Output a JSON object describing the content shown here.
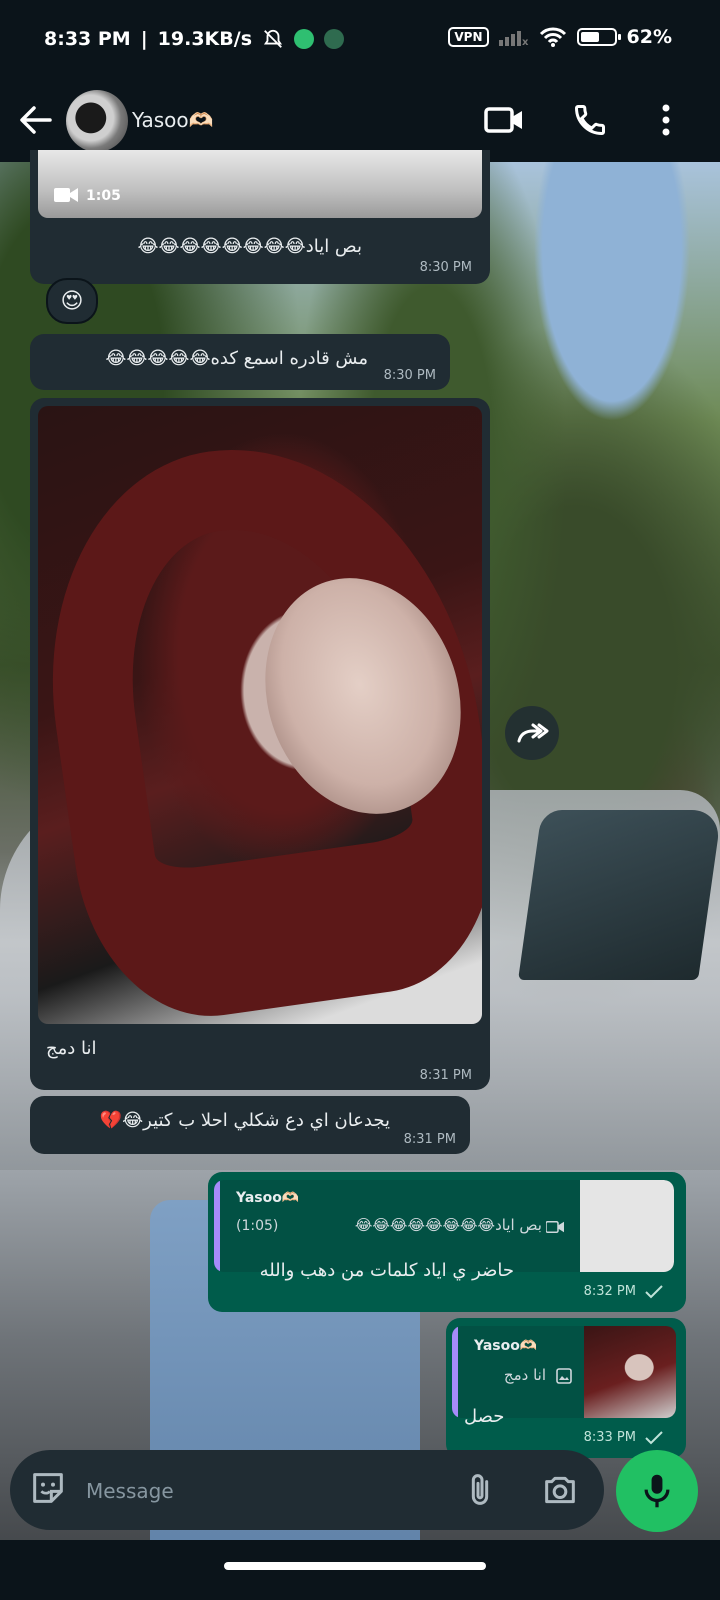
{
  "status_bar": {
    "time": "8:33 PM",
    "network_speed": "19.3KB/s",
    "vpn": "VPN",
    "battery": "62%",
    "battery_level": 0.62
  },
  "header": {
    "contact_name": "Yasoo🫶🏻"
  },
  "messages": [
    {
      "direction": "incoming",
      "type": "video",
      "video_duration": "1:05",
      "text": "بص اياد😂😂😂😂😂😂😂😂",
      "time": "8:30 PM",
      "reaction": "😍"
    },
    {
      "direction": "incoming",
      "type": "text",
      "text": "مش قادره اسمع كده😂😂😂😂😂",
      "time": "8:30 PM"
    },
    {
      "direction": "incoming",
      "type": "image",
      "text": "انا دمج",
      "time": "8:31 PM"
    },
    {
      "direction": "incoming",
      "type": "text",
      "text": "يجدعان اي دع شكلي احلا ب كتير😂💔",
      "time": "8:31 PM"
    },
    {
      "direction": "outgoing",
      "type": "reply",
      "quote_author": "Yasoo🫶🏻",
      "quote_text": "بص اياد😂😂😂😂😂😂😂😂",
      "quote_duration": "(1:05)",
      "text": "حاضر ي اياد كلمات من دهب والله",
      "time": "8:32 PM",
      "status": "sent"
    },
    {
      "direction": "outgoing",
      "type": "reply",
      "quote_author": "Yasoo🫶🏻",
      "quote_text": "انا دمج",
      "text": "حصل",
      "time": "8:33 PM",
      "status": "sent"
    }
  ],
  "composer": {
    "placeholder": "Message"
  },
  "colors": {
    "incoming_bubble": "#202c33",
    "outgoing_bubble": "#005c4b",
    "mic_button": "#21c063",
    "quote_bar": "#a78bfa"
  }
}
